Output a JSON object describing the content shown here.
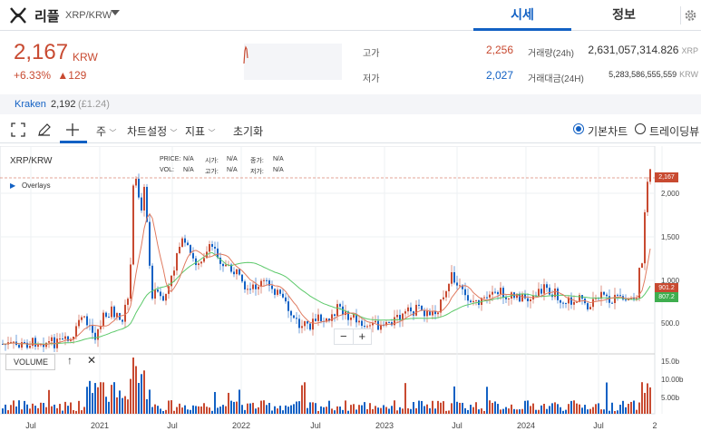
{
  "header": {
    "coin_name": "리플",
    "pair": "XRP/KRW",
    "tab_quote": "시세",
    "tab_info": "정보",
    "logo_icon": "xrp-logo-icon",
    "settings_icon": "gear-icon"
  },
  "summary": {
    "price": "2,167",
    "price_unit": "KRW",
    "change_pct": "+6.33%",
    "change_arrow": "▲",
    "change_abs": "129",
    "up_color": "#c84a31",
    "down_color": "#1261c4",
    "high_label": "고가",
    "high_value": "2,256",
    "low_label": "저가",
    "low_value": "2,027",
    "volume_label": "거래량(24h)",
    "volume_value": "2,631,057,314.826",
    "volume_unit": "XRP",
    "amount_label": "거래대금(24H)",
    "amount_value": "5,283,586,555,559",
    "amount_unit": "KRW"
  },
  "exchange": {
    "name": "Kraken",
    "price": "2,192",
    "sub": "(£1.24)"
  },
  "toolbar": {
    "period": "주",
    "chart_settings": "차트설정",
    "indicators": "지표",
    "reset": "초기화",
    "basic_chart": "기본차트",
    "tradingview": "트레이딩뷰"
  },
  "chart": {
    "symbol": "XRP/KRW",
    "overlays": "Overlays",
    "info": {
      "price_label": "PRICE:",
      "price_val": "N/A",
      "open_label": "시가:",
      "open_val": "N/A",
      "close_label": "종가:",
      "close_val": "N/A",
      "vol_label": "VOL:",
      "vol_val": "N/A",
      "high_label": "고가:",
      "high_val": "N/A",
      "low_label": "저가:",
      "low_val": "N/A"
    },
    "zoom_out": "−",
    "zoom_in": "+",
    "volume_label": "VOLUME",
    "price_ticks": [
      "2,000",
      "1,500",
      "1,000",
      "500.0"
    ],
    "volume_ticks": [
      "15.0b",
      "10.00b",
      "5.00b"
    ],
    "x_labels": [
      "Jul",
      "2021",
      "Jul",
      "2022",
      "Jul",
      "2023",
      "Jul",
      "2024",
      "Jul",
      "2"
    ],
    "badge_last": "2,167",
    "badge_ma_short": "901.2",
    "badge_ma_long": "807.2",
    "ma_short_color": "#e07a5f",
    "ma_long_color": "#5cc96a"
  }
}
